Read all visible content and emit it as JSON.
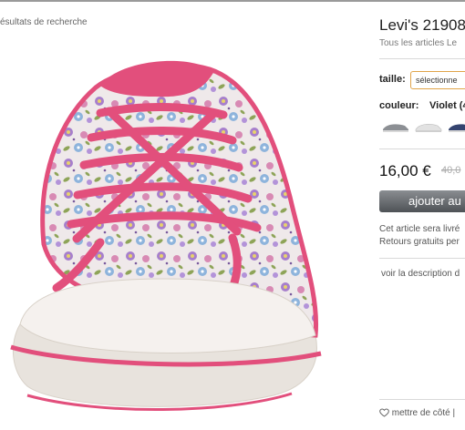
{
  "breadcrumb": {
    "back_label": "ésultats de recherche"
  },
  "product": {
    "title": "Levi's 21908",
    "brand_link": "Tous les articles Le",
    "image_alt_icon": "shoe-product-image"
  },
  "options": {
    "size_label": "taille:",
    "size_value": "sélectionne",
    "color_label": "couleur:",
    "color_value": "Violet (4",
    "swatches": [
      "grey-sneaker",
      "white-sneaker",
      "navy-sneaker"
    ]
  },
  "pricing": {
    "price": "16,00 €",
    "old_price": "40,0"
  },
  "cart": {
    "add_label": "ajouter au"
  },
  "shipping": {
    "line1": "Cet article sera livré",
    "line2": "Retours gratuits per"
  },
  "description": {
    "link": "voir la description d"
  },
  "wishlist": {
    "label": "mettre de côté |"
  },
  "colors": {
    "accent_orange": "#e0a449",
    "button_dark": "#4e5256",
    "shoe_pink": "#e24f7c"
  }
}
